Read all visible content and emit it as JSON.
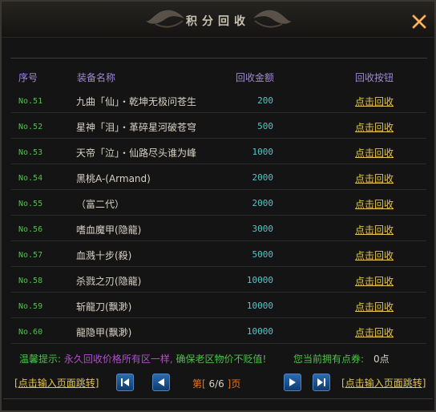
{
  "window": {
    "title": "积分回收"
  },
  "headers": {
    "no": "序号",
    "name": "装备名称",
    "amount": "回收金额",
    "action": "回收按钮"
  },
  "rows": [
    {
      "no": "No.51",
      "name": "九曲「仙」・乾坤无极问苍生",
      "amount": "200",
      "action": "点击回收"
    },
    {
      "no": "No.52",
      "name": "星神「泪」・革碎星河破苍穹",
      "amount": "500",
      "action": "点击回收"
    },
    {
      "no": "No.53",
      "name": "天帝「泣」・仙路尽头谁为峰",
      "amount": "1000",
      "action": "点击回收"
    },
    {
      "no": "No.54",
      "name": "黑桃A-(Armand)",
      "amount": "2000",
      "action": "点击回收"
    },
    {
      "no": "No.55",
      "name": "（富二代）",
      "amount": "2000",
      "action": "点击回收"
    },
    {
      "no": "No.56",
      "name": "嗜血魔甲(隐龍)",
      "amount": "3000",
      "action": "点击回收"
    },
    {
      "no": "No.57",
      "name": "血溅十步(殺)",
      "amount": "5000",
      "action": "点击回收"
    },
    {
      "no": "No.58",
      "name": "杀戮之刃(隐龍)",
      "amount": "10000",
      "action": "点击回收"
    },
    {
      "no": "No.59",
      "name": "斩龍刀(飘渺)",
      "amount": "10000",
      "action": "点击回收"
    },
    {
      "no": "No.60",
      "name": "龍隐甲(飘渺)",
      "amount": "10000",
      "action": "点击回收"
    }
  ],
  "tip": {
    "prefix": "温馨提示:",
    "main": " 永久回收价格所有区一样,",
    "suffix": " 确保老区物价不贬值!"
  },
  "points": {
    "label": "您当前拥有点券:",
    "value": "0点"
  },
  "pagination": {
    "jump_left": "点击输入页面跳转",
    "jump_right": "点击输入页面跳转",
    "prefix": "第[",
    "current": " 6/6 ",
    "suffix": "]页"
  },
  "colors": {
    "number": "#4fc14a",
    "amount": "#55c6c6",
    "action": "#e2c64a",
    "header": "#a089d6",
    "tip_highlight": "#b14fc9"
  },
  "icons": {
    "close": "close-x-icon",
    "first": "first-page-icon",
    "prev": "prev-page-icon",
    "next": "next-page-icon",
    "last": "last-page-icon"
  }
}
